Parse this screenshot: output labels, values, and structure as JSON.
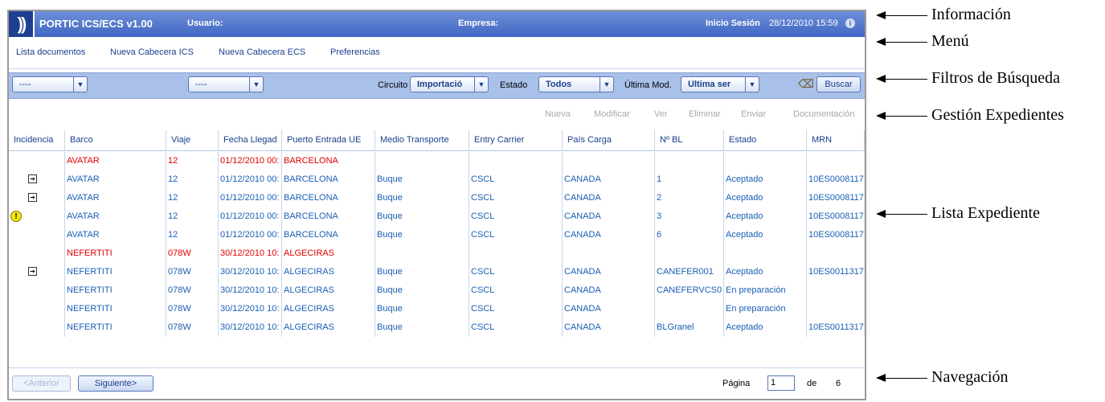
{
  "topbar": {
    "title": "PORTIC ICS/ECS v1.00",
    "usuario_label": "Usuario:",
    "empresa_label": "Empresa:",
    "inicio_label": "Inicio Sesión",
    "datetime": "28/12/2010 15:59",
    "info_icon": "i"
  },
  "menu": {
    "items": [
      "Lista documentos",
      "Nueva Cabecera ICS",
      "Nueva Cabecera ECS",
      "Preferencias"
    ]
  },
  "filters": {
    "select1": "----",
    "select2": "----",
    "circuito_label": "Circuito",
    "circuito_value": "Importació",
    "estado_label": "Estado",
    "estado_value": "Todos",
    "ultima_label": "Última Mod.",
    "ultima_value": "Última ser",
    "buscar": "Buscar"
  },
  "actions": [
    "Nueva",
    "Modificar",
    "Ver",
    "Eliminar",
    "Enviar",
    "Documentación"
  ],
  "table": {
    "headers": [
      "Incidencia",
      "Barco",
      "Viaje",
      "Fecha Llegad",
      "Puerto Entrada UE",
      "Medio Transporte",
      "Entry Carrier",
      "País Carga",
      "Nº BL",
      "Estado",
      "MRN"
    ],
    "rows": [
      {
        "icon": "",
        "group": true,
        "cells": [
          "AVATAR",
          "12",
          "01/12/2010 00:",
          "BARCELONA",
          "",
          "",
          "",
          "",
          "",
          ""
        ]
      },
      {
        "icon": "arrow",
        "group": false,
        "cells": [
          "AVATAR",
          "12",
          "01/12/2010 00:",
          "BARCELONA",
          "Buque",
          "CSCL",
          "CANADA",
          "1",
          "Aceptado",
          "10ES0008117"
        ]
      },
      {
        "icon": "arrow",
        "group": false,
        "cells": [
          "AVATAR",
          "12",
          "01/12/2010 00:",
          "BARCELONA",
          "Buque",
          "CSCL",
          "CANADA",
          "2",
          "Aceptado",
          "10ES0008117"
        ]
      },
      {
        "icon": "warning",
        "group": false,
        "cells": [
          "AVATAR",
          "12",
          "01/12/2010 00:",
          "BARCELONA",
          "Buque",
          "CSCL",
          "CANADA",
          "3",
          "Aceptado",
          "10ES0008117"
        ]
      },
      {
        "icon": "",
        "group": false,
        "cells": [
          "AVATAR",
          "12",
          "01/12/2010 00:",
          "BARCELONA",
          "Buque",
          "CSCL",
          "CANADA",
          "6",
          "Aceptado",
          "10ES0008117"
        ]
      },
      {
        "icon": "",
        "group": true,
        "cells": [
          "NEFERTITI",
          "078W",
          "30/12/2010 10:",
          "ALGECIRAS",
          "",
          "",
          "",
          "",
          "",
          ""
        ]
      },
      {
        "icon": "arrow",
        "group": false,
        "cells": [
          "NEFERTITI",
          "078W",
          "30/12/2010 10:",
          "ALGECIRAS",
          "Buque",
          "CSCL",
          "CANADA",
          "CANEFER001",
          "Aceptado",
          "10ES0011317"
        ]
      },
      {
        "icon": "",
        "group": false,
        "cells": [
          "NEFERTITI",
          "078W",
          "30/12/2010 10:",
          "ALGECIRAS",
          "Buque",
          "CSCL",
          "CANADA",
          "CANEFERVCS0",
          "En preparación",
          ""
        ]
      },
      {
        "icon": "",
        "group": false,
        "cells": [
          "NEFERTITI",
          "078W",
          "30/12/2010 10:",
          "ALGECIRAS",
          "Buque",
          "CSCL",
          "CANADA",
          "",
          "En preparación",
          ""
        ]
      },
      {
        "icon": "",
        "group": false,
        "cells": [
          "NEFERTITI",
          "078W",
          "30/12/2010 10:",
          "ALGECIRAS",
          "Buque",
          "CSCL",
          "CANADA",
          "BLGranel",
          "Aceptado",
          "10ES0011317"
        ]
      }
    ]
  },
  "navigation": {
    "anterior": "<Anterior",
    "siguiente": "Siguiente>",
    "pagina_label": "Página",
    "page": "1",
    "de_label": "de",
    "total": "6"
  },
  "annotations": [
    "Información",
    "Menú",
    "Filtros de Búsqueda",
    "Gestión Expedientes",
    "Lista Expediente",
    "Navegación"
  ],
  "colors": {
    "topbar": "#3f66c2",
    "filterbar": "#a9c0e8",
    "group_text": "#e00000",
    "link_text": "#1a5fb4"
  }
}
